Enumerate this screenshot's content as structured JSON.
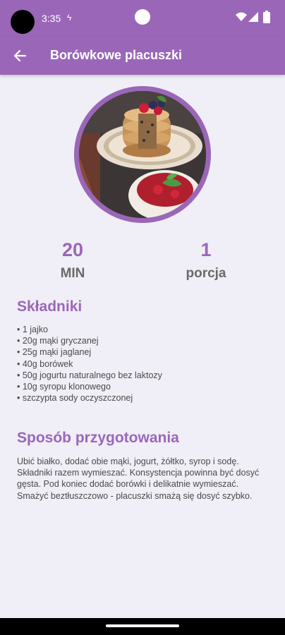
{
  "status_bar": {
    "time": "3:35"
  },
  "app_bar": {
    "title": "Borówkowe placuszki"
  },
  "stats": {
    "time_value": "20",
    "time_unit": "MIN",
    "portions_value": "1",
    "portions_unit": "porcja"
  },
  "ingredients": {
    "title": "Składniki",
    "items": [
      "• 1 jajko",
      "• 20g mąki gryczanej",
      "• 25g mąki jaglanej",
      "• 40g borówek",
      "• 50g jogurtu naturalnego bez laktozy",
      "• 10g syropu klonowego",
      "• szczypta sody oczyszczonej"
    ]
  },
  "method": {
    "title": "Sposób przygotowania",
    "text": "Ubić białko, dodać obie mąki, jogurt, żółtko, syrop i sodę. Składniki razem wymieszać. Konsystencja powinna być dosyć gęsta. Pod koniec dodać borówki i delikatnie wymieszać. Smażyć beztłuszczowo - placuszki smażą się dosyć szybko."
  },
  "colors": {
    "primary": "#9a67b8",
    "background": "#f0eef6",
    "label_gray": "#6a6a6a",
    "text": "#4a4a4a"
  },
  "icons": {
    "back": "arrow-left-icon",
    "wifi": "wifi-icon",
    "signal": "signal-icon",
    "battery": "battery-icon",
    "charge": "charging-icon"
  }
}
